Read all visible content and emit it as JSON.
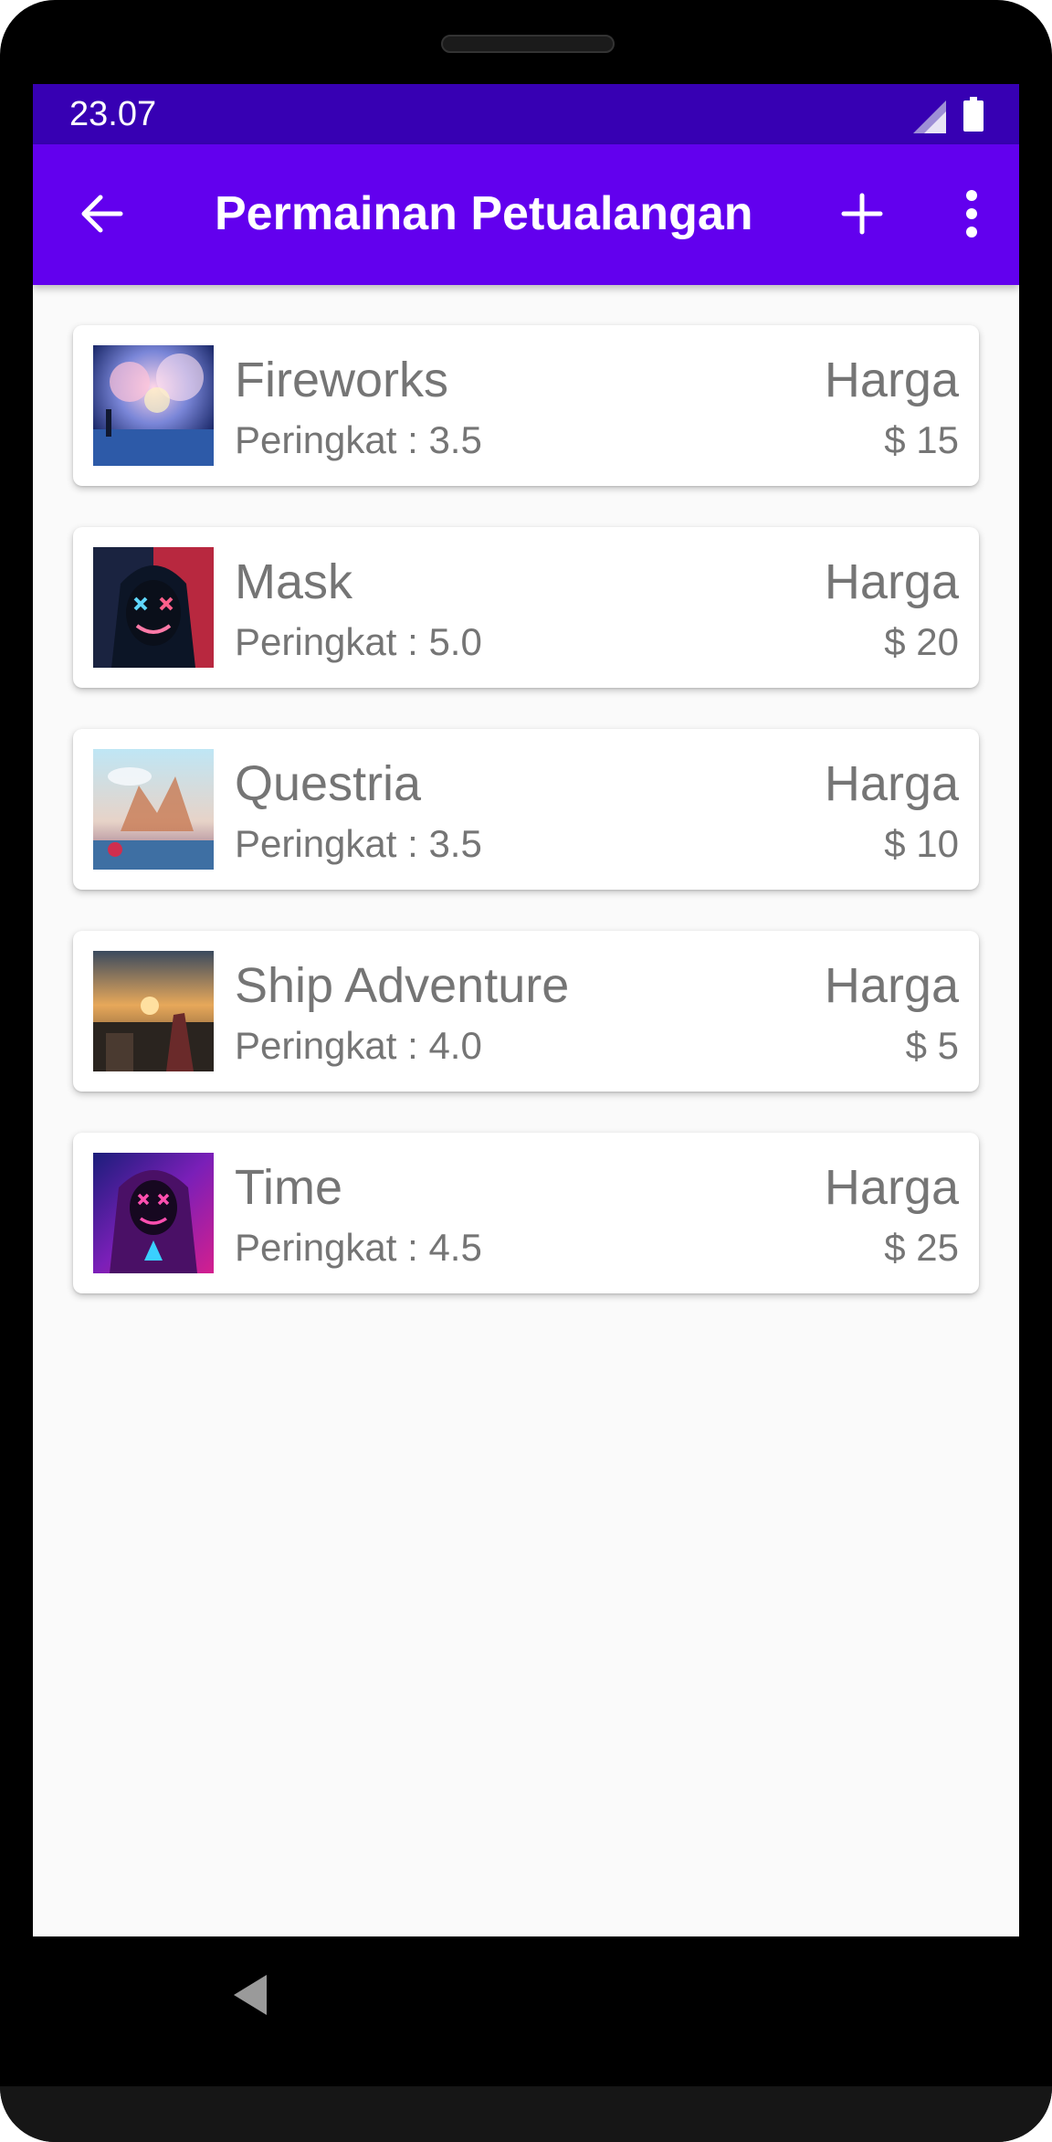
{
  "status_bar": {
    "time": "23.07",
    "icons": [
      "signal-icon",
      "battery-icon"
    ]
  },
  "app_bar": {
    "title": "Permainan Petualangan",
    "icons": [
      "back-arrow-icon",
      "add-icon",
      "more-vert-icon"
    ],
    "color": "#6200ee",
    "status_color": "#3700b3"
  },
  "games": [
    {
      "name": "Fireworks",
      "rating": "Peringkat : 3.5",
      "price_label": "Harga",
      "price": "$ 15"
    },
    {
      "name": "Mask",
      "rating": "Peringkat : 5.0",
      "price_label": "Harga",
      "price": "$ 20"
    },
    {
      "name": "Questria",
      "rating": "Peringkat : 3.5",
      "price_label": "Harga",
      "price": "$ 10"
    },
    {
      "name": "Ship Adventure",
      "rating": "Peringkat : 4.0",
      "price_label": "Harga",
      "price": "$ 5"
    },
    {
      "name": "Time",
      "rating": "Peringkat : 4.5",
      "price_label": "Harga",
      "price": "$ 25"
    }
  ],
  "nav_bar": {
    "icons": [
      "nav-back-icon"
    ]
  }
}
